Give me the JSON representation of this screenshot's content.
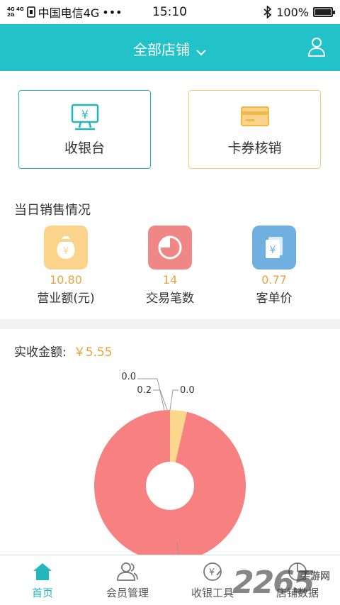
{
  "status_bar": {
    "signal_top": "4G 4G",
    "signal_bottom": "2G",
    "carrier": "中国电信4G",
    "dots": "•••",
    "time": "15:10",
    "battery": "100%",
    "battery_level": 1.0
  },
  "header": {
    "title": "全部店铺"
  },
  "actions": {
    "cashier_label": "收银台",
    "coupon_label": "卡券核销"
  },
  "sales": {
    "title": "当日销售情况",
    "stats": [
      {
        "value": "10.80",
        "caption": "营业额(元)",
        "color": "#fbd38a"
      },
      {
        "value": "14",
        "caption": "交易笔数",
        "color": "#f08787"
      },
      {
        "value": "0.77",
        "caption": "客单价",
        "color": "#6fb0e0"
      }
    ]
  },
  "received": {
    "label": "实收金额:",
    "amount": "￥5.55"
  },
  "chart_data": {
    "type": "pie",
    "slices": [
      {
        "label": "0.0",
        "value": 0.0,
        "color": "#f5a3a3"
      },
      {
        "label": "0.2",
        "value": 0.2,
        "color": "#fcd88e"
      },
      {
        "label": "0.0",
        "value": 0.0,
        "color": "#d7d7d7"
      },
      {
        "label": "",
        "value": 5.35,
        "color": "#f78080"
      }
    ]
  },
  "tabs": [
    {
      "label": "首页",
      "active": true
    },
    {
      "label": "会员管理",
      "active": false
    },
    {
      "label": "收银工具",
      "active": false
    },
    {
      "label": "店铺数据",
      "active": false
    }
  ],
  "watermark": {
    "big": "2265",
    "small": "手游网"
  },
  "colors": {
    "accent": "#22c3c8",
    "highlight": "#e8a23c"
  }
}
